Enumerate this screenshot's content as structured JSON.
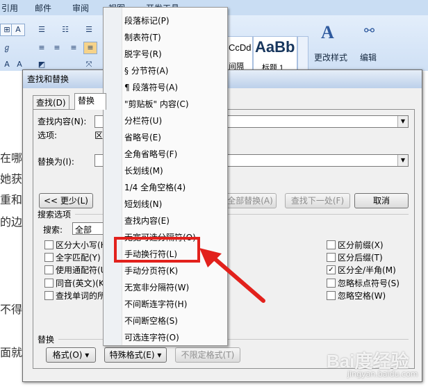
{
  "ribbon": {
    "tabs": [
      "引用",
      "邮件",
      "审阅",
      "视图",
      "开发工具"
    ],
    "styles": [
      {
        "preview": "CcDd",
        "name": "间隔"
      },
      {
        "preview": "AaBb",
        "name": "标题 1"
      }
    ],
    "change_styles_label": "更改样式",
    "edit_label": "编辑"
  },
  "doc_fragments": [
    "在哪",
    "她获",
    "重和",
    "的边",
    "不得不",
    "面就"
  ],
  "dialog": {
    "title": "查找和替换",
    "tabs": [
      "查找(D)",
      "替换(P)"
    ],
    "find_label": "查找内容(N):",
    "options_label": "选项:",
    "options_value": "区",
    "replace_label": "替换为(I):",
    "less_button": "<< 更少(L)",
    "replace_all_button": "全部替换(A)",
    "find_next_button": "查找下一处(F)",
    "cancel_button": "取消",
    "search_options_title": "搜索选项",
    "search_label": "搜索:",
    "search_value": "全部",
    "left_checks": [
      {
        "label": "区分大小写(H)",
        "checked": false
      },
      {
        "label": "全字匹配(Y)",
        "checked": false
      },
      {
        "label": "使用通配符(U)",
        "checked": false
      },
      {
        "label": "同音(英文)(K)",
        "checked": false
      },
      {
        "label": "查找单词的所有形式(英文)(W)",
        "checked": false
      }
    ],
    "right_checks": [
      {
        "label": "区分前缀(X)",
        "checked": false
      },
      {
        "label": "区分后缀(T)",
        "checked": false
      },
      {
        "label": "区分全/半角(M)",
        "checked": true
      },
      {
        "label": "忽略标点符号(S)",
        "checked": false
      },
      {
        "label": "忽略空格(W)",
        "checked": false
      }
    ],
    "replace_section_title": "替换",
    "format_button": "格式(O)",
    "special_button": "特殊格式(E)",
    "no_format_button": "不限定格式(T)"
  },
  "menu_items": [
    "段落标记(P)",
    "制表符(T)",
    "脱字号(R)",
    "§ 分节符(A)",
    "¶ 段落符号(A)",
    "\"剪贴板\" 内容(C)",
    "分栏符(U)",
    "省略号(E)",
    "全角省略号(F)",
    "长划线(M)",
    "1/4 全角空格(4)",
    "短划线(N)",
    "查找内容(E)",
    "无宽可选分隔符(O)",
    "手动换行符(L)",
    "手动分页符(K)",
    "无宽非分隔符(W)",
    "不间断连字符(H)",
    "不间断空格(S)",
    "可选连字符(O)"
  ],
  "watermark": "Bai度经验",
  "watermark_sub": "jingyan.baidu.com",
  "colors": {
    "annotation": "#e2211c",
    "ribbon": "#cfe0f5"
  }
}
